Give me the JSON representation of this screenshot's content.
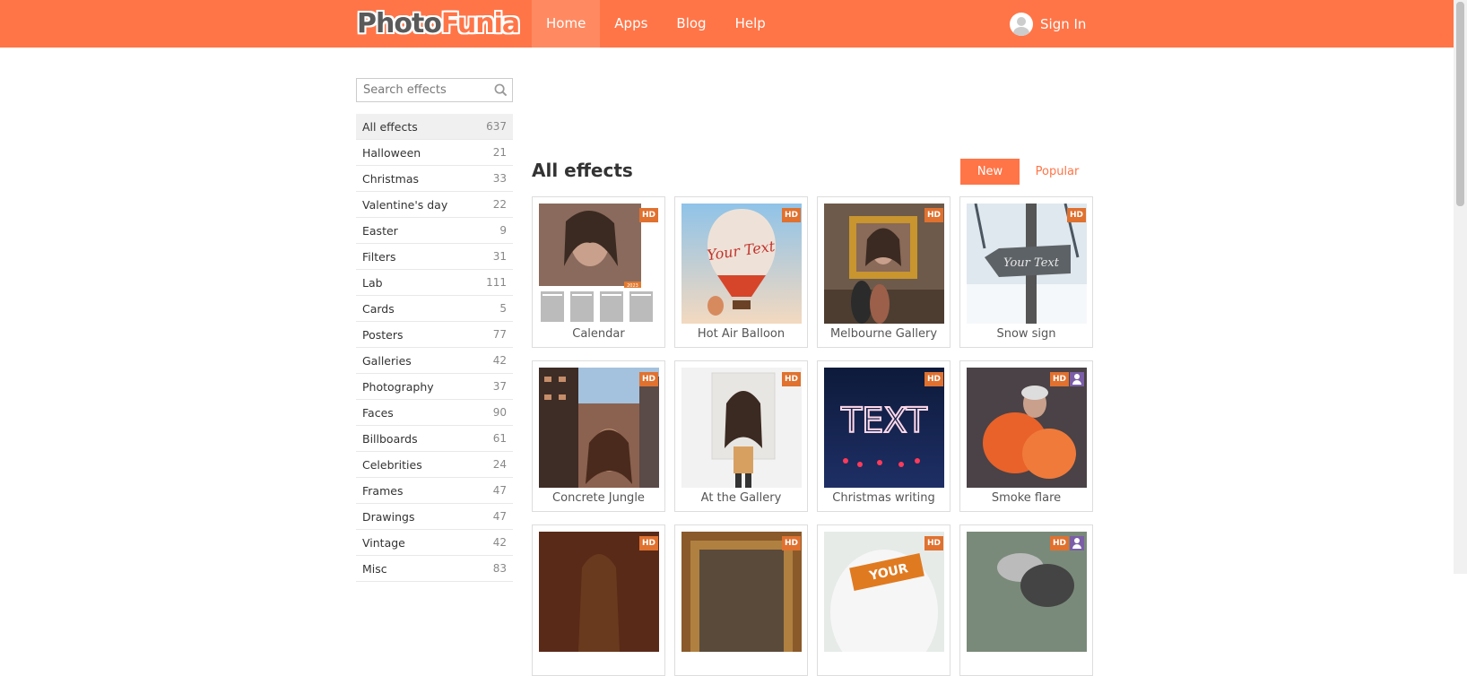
{
  "header": {
    "logo_part1": "Photo",
    "logo_part2": "Funia",
    "nav": [
      "Home",
      "Apps",
      "Blog",
      "Help"
    ],
    "signin": "Sign In",
    "brand_color": "#ff7547"
  },
  "search": {
    "placeholder": "Search effects"
  },
  "categories": [
    {
      "label": "All effects",
      "count": "637"
    },
    {
      "label": "Halloween",
      "count": "21"
    },
    {
      "label": "Christmas",
      "count": "33"
    },
    {
      "label": "Valentine's day",
      "count": "22"
    },
    {
      "label": "Easter",
      "count": "9"
    },
    {
      "label": "Filters",
      "count": "31"
    },
    {
      "label": "Lab",
      "count": "111"
    },
    {
      "label": "Cards",
      "count": "5"
    },
    {
      "label": "Posters",
      "count": "77"
    },
    {
      "label": "Galleries",
      "count": "42"
    },
    {
      "label": "Photography",
      "count": "37"
    },
    {
      "label": "Faces",
      "count": "90"
    },
    {
      "label": "Billboards",
      "count": "61"
    },
    {
      "label": "Celebrities",
      "count": "24"
    },
    {
      "label": "Frames",
      "count": "47"
    },
    {
      "label": "Drawings",
      "count": "47"
    },
    {
      "label": "Vintage",
      "count": "42"
    },
    {
      "label": "Misc",
      "count": "83"
    }
  ],
  "main": {
    "title": "All effects",
    "sort_new": "New",
    "sort_popular": "Popular"
  },
  "effects": [
    {
      "label": "Calendar",
      "badges": [
        "HD"
      ]
    },
    {
      "label": "Hot Air Balloon",
      "badges": [
        "HD"
      ]
    },
    {
      "label": "Melbourne Gallery",
      "badges": [
        "HD"
      ]
    },
    {
      "label": "Snow sign",
      "badges": [
        "HD"
      ]
    },
    {
      "label": "Concrete Jungle",
      "badges": [
        "HD"
      ]
    },
    {
      "label": "At the Gallery",
      "badges": [
        "HD"
      ]
    },
    {
      "label": "Christmas writing",
      "badges": [
        "HD"
      ]
    },
    {
      "label": "Smoke flare",
      "badges": [
        "HD",
        "user"
      ]
    },
    {
      "label": "",
      "badges": [
        "HD"
      ]
    },
    {
      "label": "",
      "badges": [
        "HD"
      ]
    },
    {
      "label": "",
      "badges": [
        "HD"
      ]
    },
    {
      "label": "",
      "badges": [
        "HD",
        "user"
      ]
    }
  ],
  "thumb_texts": {
    "balloon": "Your Text",
    "snow": "Your Text",
    "christmas": "TEXT",
    "calendar_year": "2023",
    "poster": "YOUR"
  }
}
